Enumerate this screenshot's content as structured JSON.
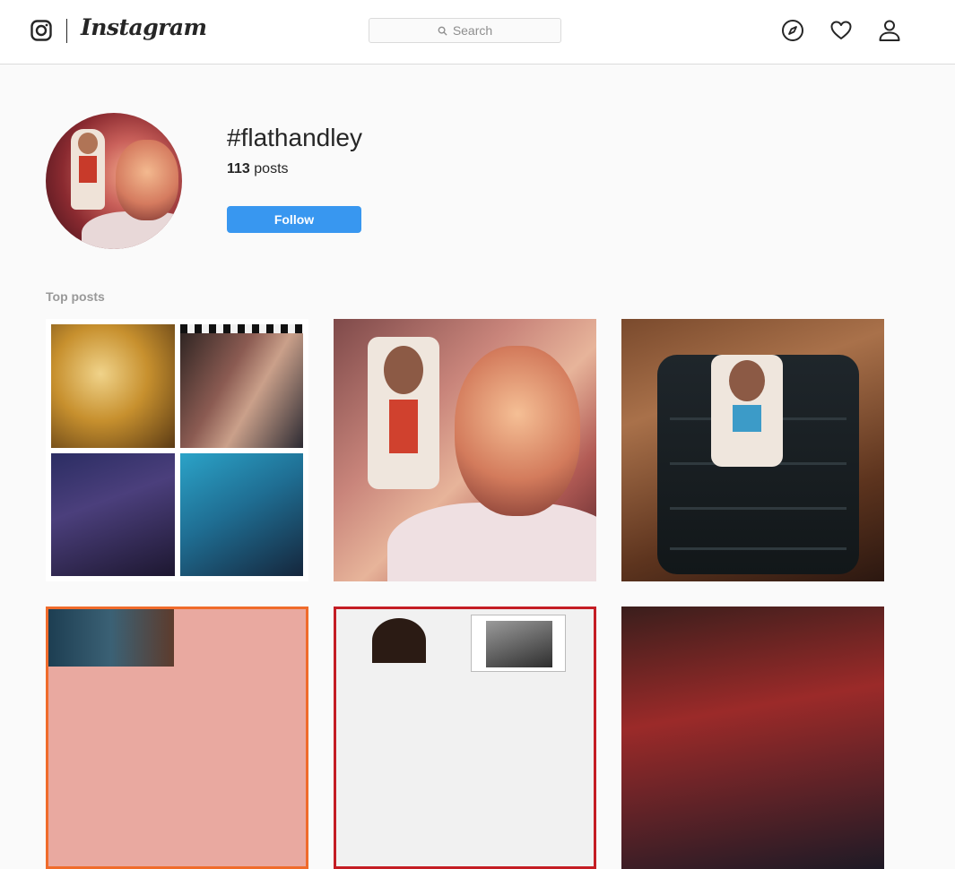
{
  "header": {
    "brand": "Instagram",
    "search": {
      "placeholder": "Search"
    },
    "nav_icons": [
      "compass-icon",
      "heart-icon",
      "person-icon"
    ]
  },
  "hashtag": {
    "title": "#flathandley",
    "post_count": "113",
    "post_count_label": "posts",
    "follow_label": "Follow"
  },
  "sections": {
    "top_posts_label": "Top posts"
  },
  "colors": {
    "follow_button": "#3897f0",
    "header_bg": "#ffffff",
    "page_bg": "#fafafa",
    "border": "#dbdbdb",
    "section_label": "#999999"
  }
}
